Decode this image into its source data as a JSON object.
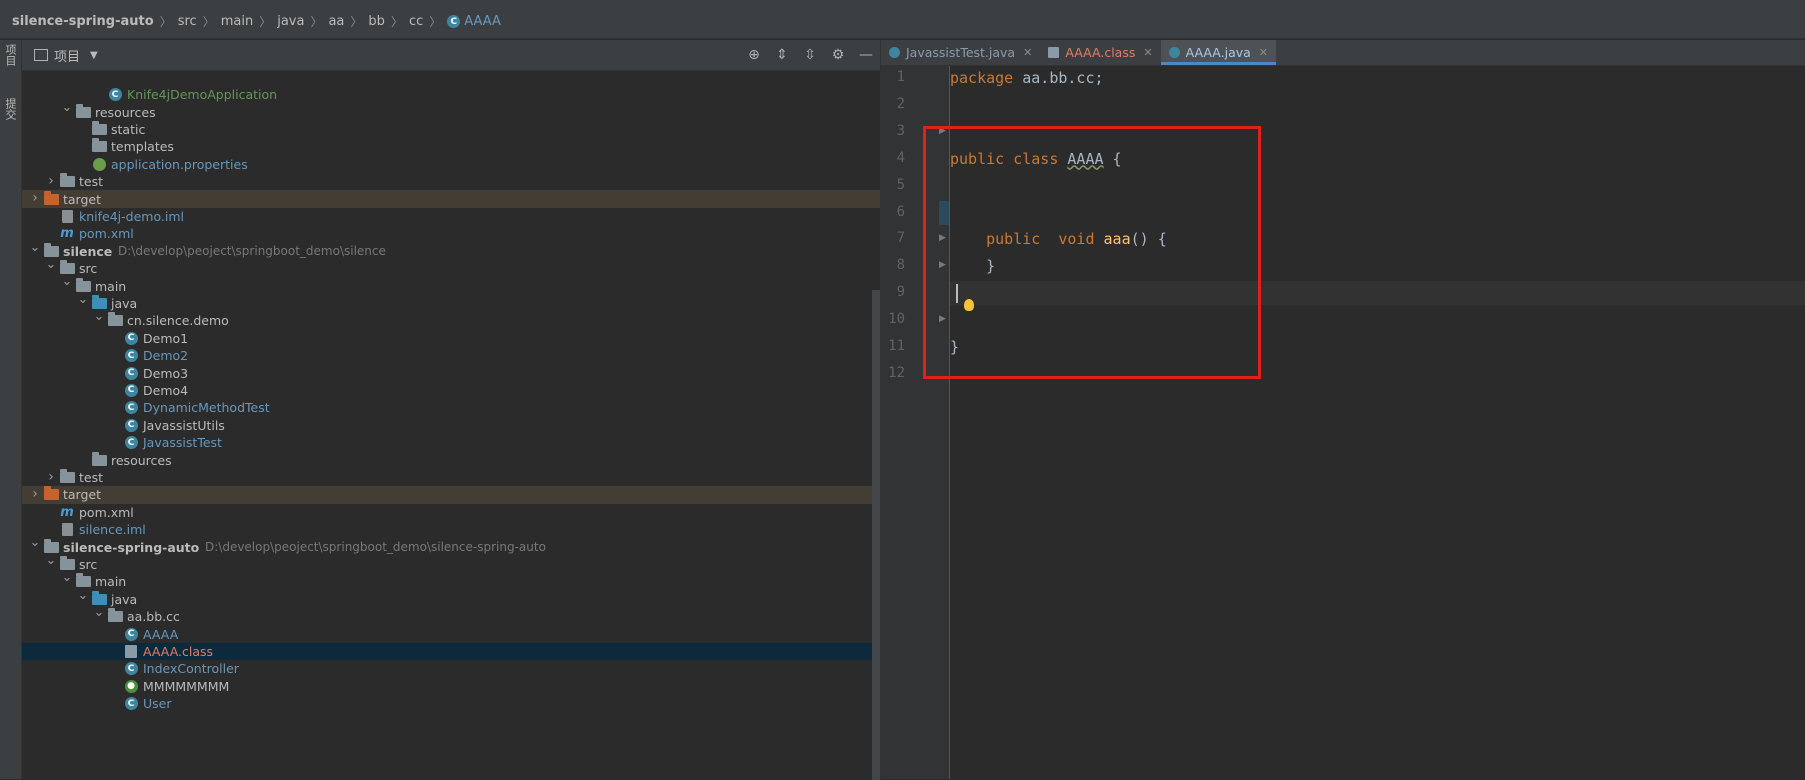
{
  "breadcrumb": [
    {
      "label": "silence-spring-auto",
      "bold": true
    },
    {
      "label": "src"
    },
    {
      "label": "main"
    },
    {
      "label": "java"
    },
    {
      "label": "aa"
    },
    {
      "label": "bb"
    },
    {
      "label": "cc"
    },
    {
      "label": "AAAA",
      "icon": "class-icon"
    }
  ],
  "left_strip": {
    "project": "项目",
    "commit": "提交"
  },
  "project_panel": {
    "title": "项目",
    "tools": [
      "locate-icon",
      "expand-all-icon",
      "collapse-all-icon",
      "gear-icon",
      "minimize-icon"
    ]
  },
  "tree": [
    {
      "label": "Knife4jDemoApplication",
      "icon": "spring-class",
      "indent": 5,
      "color": "green"
    },
    {
      "label": "resources",
      "icon": "res-folder",
      "indent": 3,
      "arrow": "open"
    },
    {
      "label": "static",
      "icon": "folder",
      "indent": 4
    },
    {
      "label": "templates",
      "icon": "folder",
      "indent": 4
    },
    {
      "label": "application.properties",
      "icon": "properties",
      "indent": 4,
      "color": "blue"
    },
    {
      "label": "test",
      "icon": "folder",
      "indent": 2,
      "arrow": "closed"
    },
    {
      "label": "target",
      "icon": "orange-folder",
      "indent": 1,
      "arrow": "closed",
      "highlight": "target"
    },
    {
      "label": "knife4j-demo.iml",
      "icon": "file",
      "indent": 2,
      "color": "blue"
    },
    {
      "label": "pom.xml",
      "icon": "maven",
      "indent": 2,
      "color": "blue"
    },
    {
      "label": "silence",
      "icon": "module",
      "indent": 1,
      "arrow": "open",
      "bold": true,
      "path": "D:\\develop\\peoject\\springboot_demo\\silence"
    },
    {
      "label": "src",
      "icon": "folder",
      "indent": 2,
      "arrow": "open"
    },
    {
      "label": "main",
      "icon": "folder",
      "indent": 3,
      "arrow": "open"
    },
    {
      "label": "java",
      "icon": "blue-folder",
      "indent": 4,
      "arrow": "open"
    },
    {
      "label": "cn.silence.demo",
      "icon": "folder",
      "indent": 5,
      "arrow": "open"
    },
    {
      "label": "Demo1",
      "icon": "class",
      "indent": 6
    },
    {
      "label": "Demo2",
      "icon": "class",
      "indent": 6,
      "color": "blue"
    },
    {
      "label": "Demo3",
      "icon": "class",
      "indent": 6
    },
    {
      "label": "Demo4",
      "icon": "spring-class",
      "indent": 6
    },
    {
      "label": "DynamicMethodTest",
      "icon": "spring-class",
      "indent": 6,
      "color": "blue"
    },
    {
      "label": "JavassistUtils",
      "icon": "class",
      "indent": 6
    },
    {
      "label": "JavassistTest",
      "icon": "class",
      "indent": 6,
      "color": "blue"
    },
    {
      "label": "resources",
      "icon": "res-folder",
      "indent": 4
    },
    {
      "label": "test",
      "icon": "folder",
      "indent": 2,
      "arrow": "closed"
    },
    {
      "label": "target",
      "icon": "orange-folder",
      "indent": 1,
      "arrow": "closed",
      "highlight": "target"
    },
    {
      "label": "pom.xml",
      "icon": "maven",
      "indent": 2
    },
    {
      "label": "silence.iml",
      "icon": "file",
      "indent": 2,
      "color": "blue"
    },
    {
      "label": "silence-spring-auto",
      "icon": "module",
      "indent": 1,
      "arrow": "open",
      "bold": true,
      "path": "D:\\develop\\peoject\\springboot_demo\\silence-spring-auto"
    },
    {
      "label": "src",
      "icon": "folder",
      "indent": 2,
      "arrow": "open"
    },
    {
      "label": "main",
      "icon": "folder",
      "indent": 3,
      "arrow": "open"
    },
    {
      "label": "java",
      "icon": "blue-folder",
      "indent": 4,
      "arrow": "open"
    },
    {
      "label": "aa.bb.cc",
      "icon": "folder",
      "indent": 5,
      "arrow": "open"
    },
    {
      "label": "AAAA",
      "icon": "class",
      "indent": 6,
      "color": "blue"
    },
    {
      "label": "AAAA.class",
      "icon": "binary",
      "indent": 6,
      "color": "red",
      "highlight": "selected"
    },
    {
      "label": "IndexController",
      "icon": "class",
      "indent": 6,
      "color": "blue"
    },
    {
      "label": "MMMMMMMM",
      "icon": "green-class",
      "indent": 6
    },
    {
      "label": "User",
      "icon": "class",
      "indent": 6,
      "color": "blue"
    }
  ],
  "tabs": [
    {
      "label": "JavassistTest.java",
      "icon": "class",
      "active": false,
      "color": "normal"
    },
    {
      "label": "AAAA.class",
      "icon": "binary",
      "active": false,
      "color": "red"
    },
    {
      "label": "AAAA.java",
      "icon": "class",
      "active": true,
      "color": "normal"
    }
  ],
  "code_lines": [
    {
      "n": "1",
      "tokens": [
        [
          "kw",
          "package "
        ],
        [
          "id",
          "aa.bb.cc;"
        ]
      ]
    },
    {
      "n": "2",
      "tokens": []
    },
    {
      "n": "3",
      "tokens": []
    },
    {
      "n": "4",
      "tokens": [
        [
          "kw",
          "public class "
        ],
        [
          "sq",
          "AAAA"
        ],
        [
          "id",
          " {"
        ]
      ]
    },
    {
      "n": "5",
      "tokens": []
    },
    {
      "n": "6",
      "tokens": []
    },
    {
      "n": "7",
      "tokens": [
        [
          "id",
          "    "
        ],
        [
          "kw",
          "public  void "
        ],
        [
          "meth",
          "aaa"
        ],
        [
          "id",
          "() {"
        ]
      ]
    },
    {
      "n": "8",
      "tokens": [
        [
          "id",
          "    }"
        ]
      ]
    },
    {
      "n": "9",
      "tokens": []
    },
    {
      "n": "10",
      "tokens": []
    },
    {
      "n": "11",
      "tokens": [
        [
          "id",
          "}"
        ]
      ]
    },
    {
      "n": "12",
      "tokens": []
    }
  ],
  "colors": {
    "accent": "#4a88c7",
    "highlight_box": "#e0201a",
    "keyword": "#cc7832",
    "method": "#ffc66d"
  }
}
